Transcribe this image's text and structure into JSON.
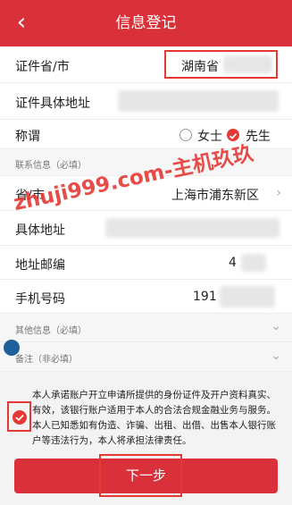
{
  "header": {
    "back_icon": "chevron-left-icon",
    "title": "信息登记"
  },
  "id_province": {
    "label": "证件省/市",
    "value": "湖南省"
  },
  "id_address": {
    "label": "证件具体地址",
    "value": ""
  },
  "salutation": {
    "label": "称谓",
    "female": "女士",
    "male": "先生",
    "selected": "先生"
  },
  "contact_section": {
    "title": "联系信息（必填）"
  },
  "province": {
    "label": "省/市",
    "value": "上海市浦东新区"
  },
  "address": {
    "label": "具体地址",
    "value": ""
  },
  "zip": {
    "label": "地址邮编",
    "value": "4"
  },
  "phone": {
    "label": "手机号码",
    "value": "191"
  },
  "other_section": {
    "title": "其他信息（必填）"
  },
  "remark_section": {
    "title": "备注（非必填）"
  },
  "agreement": {
    "text": "本人承诺账户开立申请所提供的身份证件及开户资料真实、有效，该银行账户适用于本人的合法合规金融业务与服务。本人已知悉如有伪造、诈骗、出租、出借、出售本人银行账户等违法行为，本人将承担法律责任。",
    "checked": true
  },
  "next_button": {
    "label": "下一步"
  },
  "watermark": {
    "text": "zhuji999.com-主机玖玖"
  },
  "colors": {
    "brand_red": "#d9303a",
    "highlight_red": "#e53935"
  }
}
